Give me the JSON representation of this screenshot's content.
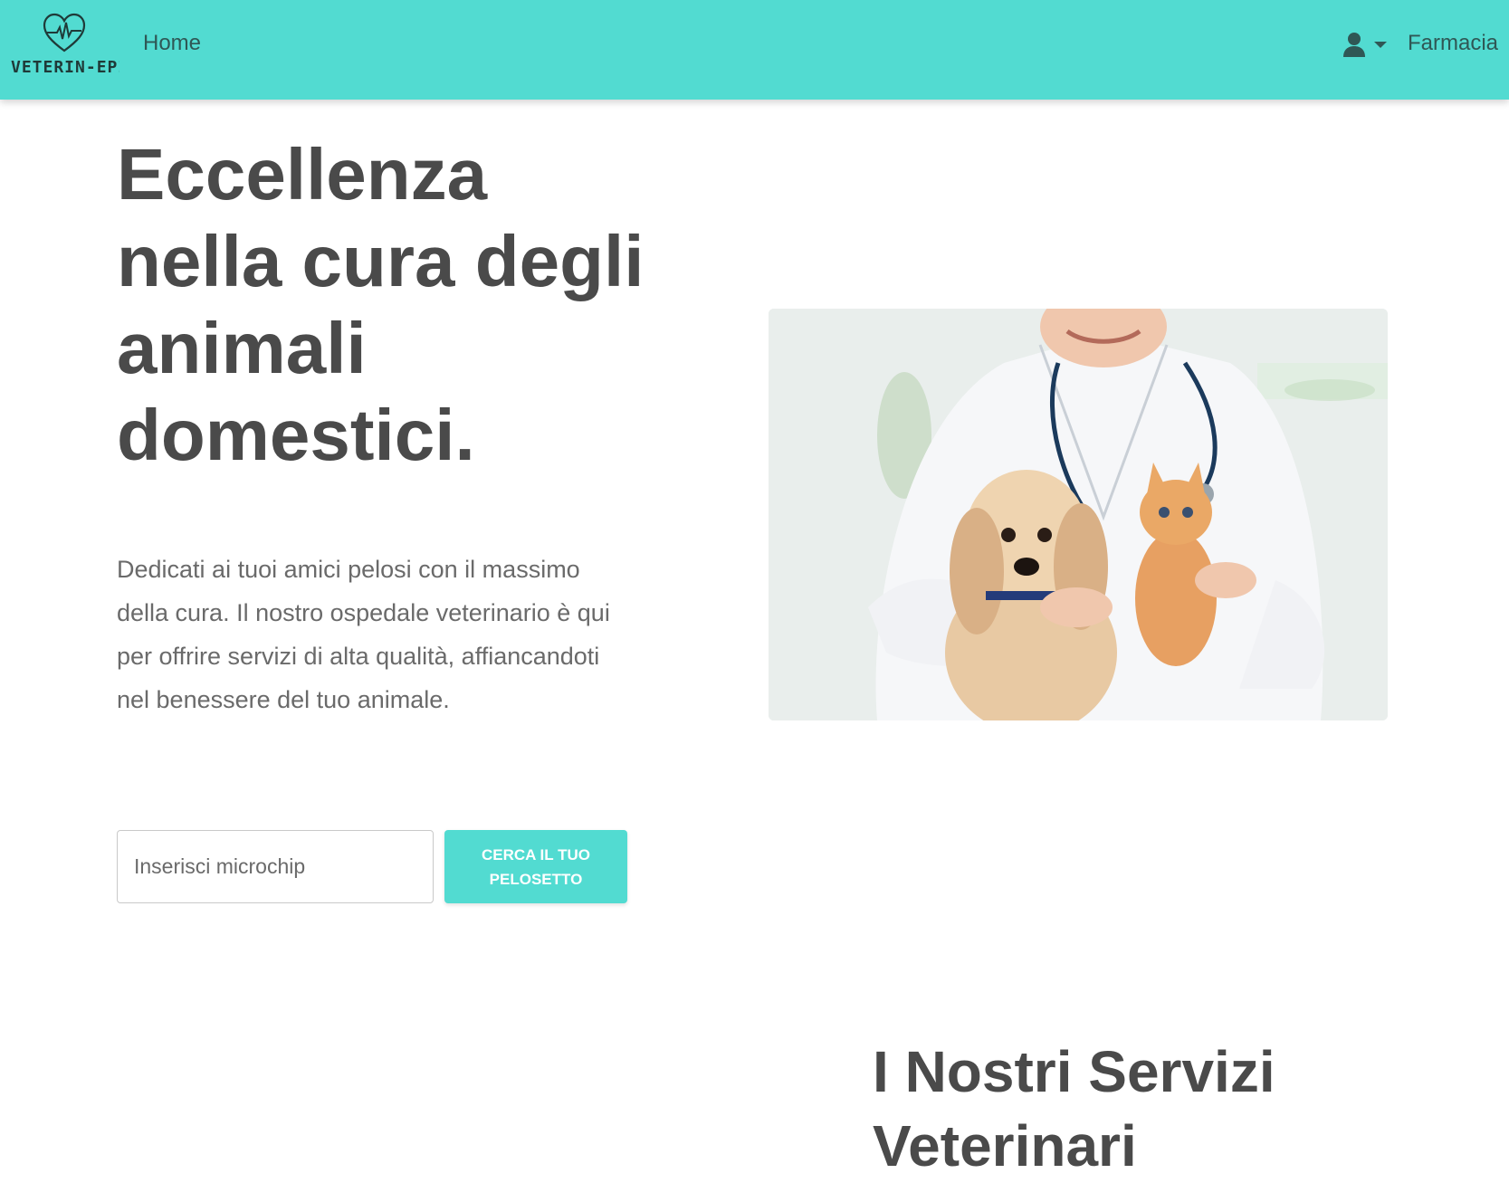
{
  "navbar": {
    "brand_name": "VETERIN-EPI",
    "home_label": "Home",
    "pharmacy_label": "Farmacia",
    "background_color": "#52dbd1"
  },
  "hero": {
    "title": "Eccellenza nella cura degli animali domestici.",
    "description": "Dedicati ai tuoi amici pelosi con il massimo della cura. Il nostro ospedale veterinario è qui per offrire servizi di alta qualità, affiancandoti nel benessere del tuo animale.",
    "search": {
      "placeholder": "Inserisci microchip",
      "value": "",
      "button_label": "CERCA IL TUO PELOSETTO"
    },
    "image_alt": "Veterinaria con cane e gattino"
  },
  "services": {
    "title": "I Nostri Servizi Veterinari"
  },
  "icons": {
    "logo": "heart-pulse-icon",
    "user": "user-icon",
    "dropdown": "caret-down-icon"
  },
  "colors": {
    "accent": "#52dbd1",
    "heading": "#4a4a4a",
    "body_text": "#6a6a6a",
    "nav_text": "#2f5755"
  }
}
